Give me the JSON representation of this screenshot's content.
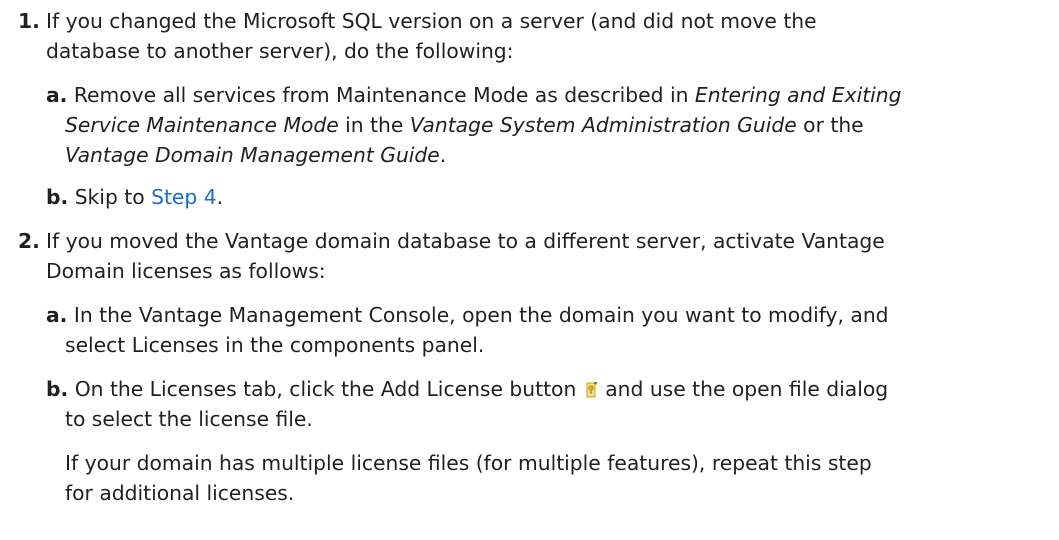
{
  "step1": {
    "number": "1.",
    "line1": "If you changed the Microsoft SQL version on a server (and did not move the",
    "line2": "database to another server), do the following:",
    "sub_a": {
      "letter": "a.",
      "text_start": "Remove all services from Maintenance Mode as described in ",
      "ref1": "Entering and Exiting",
      "ref1_cont": "Service Maintenance Mode",
      "mid": " in the ",
      "ref2": "Vantage System Administration Guide",
      "or": " or the",
      "ref3": "Vantage Domain Management Guide",
      "end": "."
    },
    "sub_b": {
      "letter": "b.",
      "text": "Skip to ",
      "link": "Step 4",
      "end": "."
    }
  },
  "step2": {
    "number": "2.",
    "line1": "If you moved the Vantage domain database to a different server, activate Vantage",
    "line2": "Domain licenses as follows:",
    "sub_a": {
      "letter": "a.",
      "line1": "In the Vantage Management Console, open the domain you want to modify, and",
      "line2": "select Licenses in the components panel."
    },
    "sub_b": {
      "letter": "b.",
      "line1_start": "On the Licenses tab, click the Add License button",
      "icon": "add-license-icon",
      "line1_end": " and use the open file dialog",
      "line2": "to select the license file.",
      "note_line1": "If your domain has multiple license files (for multiple features), repeat this step",
      "note_line2": "for additional licenses."
    }
  },
  "colors": {
    "text": "#231f20",
    "link": "#1a6ec4"
  }
}
